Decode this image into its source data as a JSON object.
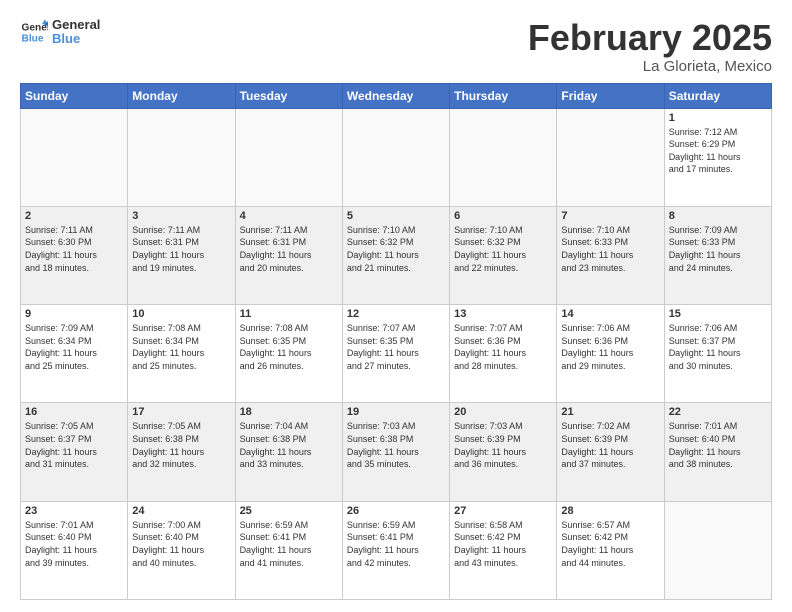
{
  "logo": {
    "line1": "General",
    "line2": "Blue"
  },
  "title": "February 2025",
  "location": "La Glorieta, Mexico",
  "days_of_week": [
    "Sunday",
    "Monday",
    "Tuesday",
    "Wednesday",
    "Thursday",
    "Friday",
    "Saturday"
  ],
  "weeks": [
    [
      {
        "day": "",
        "info": ""
      },
      {
        "day": "",
        "info": ""
      },
      {
        "day": "",
        "info": ""
      },
      {
        "day": "",
        "info": ""
      },
      {
        "day": "",
        "info": ""
      },
      {
        "day": "",
        "info": ""
      },
      {
        "day": "1",
        "info": "Sunrise: 7:12 AM\nSunset: 6:29 PM\nDaylight: 11 hours\nand 17 minutes."
      }
    ],
    [
      {
        "day": "2",
        "info": "Sunrise: 7:11 AM\nSunset: 6:30 PM\nDaylight: 11 hours\nand 18 minutes."
      },
      {
        "day": "3",
        "info": "Sunrise: 7:11 AM\nSunset: 6:31 PM\nDaylight: 11 hours\nand 19 minutes."
      },
      {
        "day": "4",
        "info": "Sunrise: 7:11 AM\nSunset: 6:31 PM\nDaylight: 11 hours\nand 20 minutes."
      },
      {
        "day": "5",
        "info": "Sunrise: 7:10 AM\nSunset: 6:32 PM\nDaylight: 11 hours\nand 21 minutes."
      },
      {
        "day": "6",
        "info": "Sunrise: 7:10 AM\nSunset: 6:32 PM\nDaylight: 11 hours\nand 22 minutes."
      },
      {
        "day": "7",
        "info": "Sunrise: 7:10 AM\nSunset: 6:33 PM\nDaylight: 11 hours\nand 23 minutes."
      },
      {
        "day": "8",
        "info": "Sunrise: 7:09 AM\nSunset: 6:33 PM\nDaylight: 11 hours\nand 24 minutes."
      }
    ],
    [
      {
        "day": "9",
        "info": "Sunrise: 7:09 AM\nSunset: 6:34 PM\nDaylight: 11 hours\nand 25 minutes."
      },
      {
        "day": "10",
        "info": "Sunrise: 7:08 AM\nSunset: 6:34 PM\nDaylight: 11 hours\nand 25 minutes."
      },
      {
        "day": "11",
        "info": "Sunrise: 7:08 AM\nSunset: 6:35 PM\nDaylight: 11 hours\nand 26 minutes."
      },
      {
        "day": "12",
        "info": "Sunrise: 7:07 AM\nSunset: 6:35 PM\nDaylight: 11 hours\nand 27 minutes."
      },
      {
        "day": "13",
        "info": "Sunrise: 7:07 AM\nSunset: 6:36 PM\nDaylight: 11 hours\nand 28 minutes."
      },
      {
        "day": "14",
        "info": "Sunrise: 7:06 AM\nSunset: 6:36 PM\nDaylight: 11 hours\nand 29 minutes."
      },
      {
        "day": "15",
        "info": "Sunrise: 7:06 AM\nSunset: 6:37 PM\nDaylight: 11 hours\nand 30 minutes."
      }
    ],
    [
      {
        "day": "16",
        "info": "Sunrise: 7:05 AM\nSunset: 6:37 PM\nDaylight: 11 hours\nand 31 minutes."
      },
      {
        "day": "17",
        "info": "Sunrise: 7:05 AM\nSunset: 6:38 PM\nDaylight: 11 hours\nand 32 minutes."
      },
      {
        "day": "18",
        "info": "Sunrise: 7:04 AM\nSunset: 6:38 PM\nDaylight: 11 hours\nand 33 minutes."
      },
      {
        "day": "19",
        "info": "Sunrise: 7:03 AM\nSunset: 6:38 PM\nDaylight: 11 hours\nand 35 minutes."
      },
      {
        "day": "20",
        "info": "Sunrise: 7:03 AM\nSunset: 6:39 PM\nDaylight: 11 hours\nand 36 minutes."
      },
      {
        "day": "21",
        "info": "Sunrise: 7:02 AM\nSunset: 6:39 PM\nDaylight: 11 hours\nand 37 minutes."
      },
      {
        "day": "22",
        "info": "Sunrise: 7:01 AM\nSunset: 6:40 PM\nDaylight: 11 hours\nand 38 minutes."
      }
    ],
    [
      {
        "day": "23",
        "info": "Sunrise: 7:01 AM\nSunset: 6:40 PM\nDaylight: 11 hours\nand 39 minutes."
      },
      {
        "day": "24",
        "info": "Sunrise: 7:00 AM\nSunset: 6:40 PM\nDaylight: 11 hours\nand 40 minutes."
      },
      {
        "day": "25",
        "info": "Sunrise: 6:59 AM\nSunset: 6:41 PM\nDaylight: 11 hours\nand 41 minutes."
      },
      {
        "day": "26",
        "info": "Sunrise: 6:59 AM\nSunset: 6:41 PM\nDaylight: 11 hours\nand 42 minutes."
      },
      {
        "day": "27",
        "info": "Sunrise: 6:58 AM\nSunset: 6:42 PM\nDaylight: 11 hours\nand 43 minutes."
      },
      {
        "day": "28",
        "info": "Sunrise: 6:57 AM\nSunset: 6:42 PM\nDaylight: 11 hours\nand 44 minutes."
      },
      {
        "day": "",
        "info": ""
      }
    ]
  ],
  "shaded_rows": [
    1,
    3
  ],
  "accent_color": "#4472c4"
}
